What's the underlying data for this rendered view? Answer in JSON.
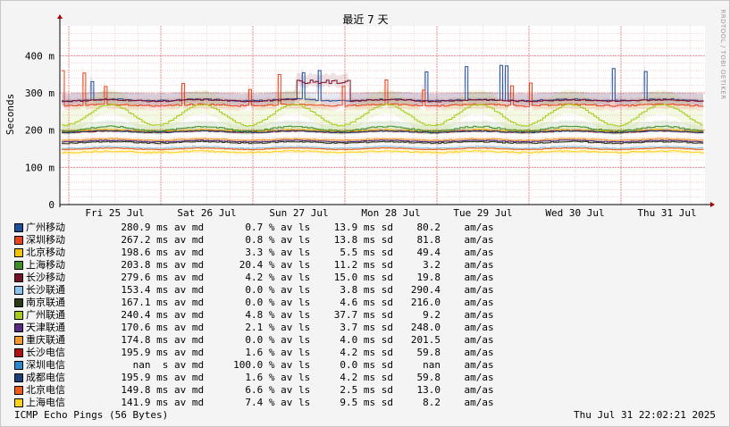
{
  "chart_data": {
    "type": "line",
    "title": "最近 7 天",
    "ylabel": "Seconds",
    "watermark": "RRDTOOL / TOBI OETIKER",
    "ylim": [
      0,
      480
    ],
    "y_unit": "m",
    "y_ticks": [
      {
        "value": 0,
        "label": "0"
      },
      {
        "value": 100,
        "label": "100 m"
      },
      {
        "value": 200,
        "label": "200 m"
      },
      {
        "value": 300,
        "label": "300 m"
      },
      {
        "value": 400,
        "label": "400 m"
      }
    ],
    "x_days": 7,
    "x_ticks": [
      "Fri 25 Jul",
      "Sat 26 Jul",
      "Sun 27 Jul",
      "Mon 28 Jul",
      "Tue 29 Jul",
      "Wed 30 Jul",
      "Thu 31 Jul"
    ],
    "grid": true,
    "legend_position": "bottom-left",
    "series": [
      {
        "name": "广州移动",
        "color": "#1f4e9a",
        "median": "280.9",
        "median_unit": "ms",
        "loss": "0.7",
        "sd": "13.9",
        "ratio": "80.2"
      },
      {
        "name": "深圳移动",
        "color": "#e8431c",
        "median": "267.2",
        "median_unit": "ms",
        "loss": "0.8",
        "sd": "13.8",
        "ratio": "81.8"
      },
      {
        "name": "北京移动",
        "color": "#f5c400",
        "median": "198.6",
        "median_unit": "ms",
        "loss": "3.3",
        "sd": "5.5",
        "ratio": "49.4"
      },
      {
        "name": "上海移动",
        "color": "#3e8e2a",
        "median": "203.8",
        "median_unit": "ms",
        "loss": "20.4",
        "sd": "11.2",
        "ratio": "3.2"
      },
      {
        "name": "长沙移动",
        "color": "#7a0f2a",
        "median": "279.6",
        "median_unit": "ms",
        "loss": "4.2",
        "sd": "15.0",
        "ratio": "19.8"
      },
      {
        "name": "长沙联通",
        "color": "#88c4ee",
        "median": "153.4",
        "median_unit": "ms",
        "loss": "0.0",
        "sd": "3.8",
        "ratio": "290.4"
      },
      {
        "name": "南京联通",
        "color": "#2a3a12",
        "median": "167.1",
        "median_unit": "ms",
        "loss": "0.0",
        "sd": "4.6",
        "ratio": "216.0"
      },
      {
        "name": "广州联通",
        "color": "#a8cc1e",
        "median": "240.4",
        "median_unit": "ms",
        "loss": "4.8",
        "sd": "37.7",
        "ratio": "9.2"
      },
      {
        "name": "天津联通",
        "color": "#5a2a82",
        "median": "170.6",
        "median_unit": "ms",
        "loss": "2.1",
        "sd": "3.7",
        "ratio": "248.0"
      },
      {
        "name": "重庆联通",
        "color": "#f39a2a",
        "median": "174.8",
        "median_unit": "ms",
        "loss": "0.0",
        "sd": "4.0",
        "ratio": "201.5"
      },
      {
        "name": "长沙电信",
        "color": "#b01010",
        "median": "195.9",
        "median_unit": "ms",
        "loss": "1.6",
        "sd": "4.2",
        "ratio": "59.8"
      },
      {
        "name": "深圳电信",
        "color": "#2a8ad0",
        "median": "nan",
        "median_unit": " s",
        "loss": "100.0",
        "sd": "0.0",
        "ratio": "nan"
      },
      {
        "name": "成都电信",
        "color": "#1a3f7a",
        "median": "195.9",
        "median_unit": "ms",
        "loss": "1.6",
        "sd": "4.2",
        "ratio": "59.8"
      },
      {
        "name": "北京电信",
        "color": "#f05a1a",
        "median": "149.8",
        "median_unit": "ms",
        "loss": "6.6",
        "sd": "2.5",
        "ratio": "13.0"
      },
      {
        "name": "上海电信",
        "color": "#ffd21a",
        "median": "141.9",
        "median_unit": "ms",
        "loss": "7.4",
        "sd": "9.5",
        "ratio": "8.2"
      }
    ],
    "legend_labels": {
      "av_md": "av md",
      "av_ls": "% av ls",
      "sd": "ms sd",
      "am": "am/as"
    }
  },
  "footer": {
    "left": "ICMP Echo Pings (56 Bytes)",
    "right": "Thu Jul 31 22:02:21 2025"
  }
}
